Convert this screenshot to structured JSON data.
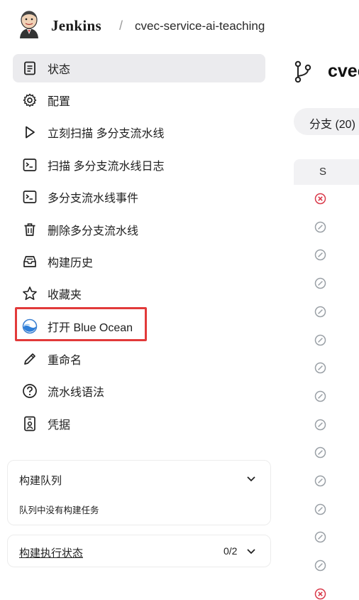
{
  "header": {
    "brand": "Jenkins",
    "separator": "/",
    "breadcrumb": "cvec-service-ai-teaching"
  },
  "sidebar": {
    "items": [
      {
        "label": "状态",
        "icon": "document-icon",
        "active": true
      },
      {
        "label": "配置",
        "icon": "gear-icon"
      },
      {
        "label": "立刻扫描 多分支流水线",
        "icon": "play-icon"
      },
      {
        "label": "扫描 多分支流水线日志",
        "icon": "terminal-icon"
      },
      {
        "label": "多分支流水线事件",
        "icon": "terminal-icon"
      },
      {
        "label": "删除多分支流水线",
        "icon": "trash-icon"
      },
      {
        "label": "构建历史",
        "icon": "inbox-icon"
      },
      {
        "label": "收藏夹",
        "icon": "star-icon"
      },
      {
        "label": "打开 Blue Ocean",
        "icon": "blue-ocean-icon",
        "highlighted": true
      },
      {
        "label": "重命名",
        "icon": "pencil-icon"
      },
      {
        "label": "流水线语法",
        "icon": "help-circle-icon"
      },
      {
        "label": "凭据",
        "icon": "credentials-icon"
      }
    ]
  },
  "build_queue": {
    "title": "构建队列",
    "empty_text": "队列中没有构建任务"
  },
  "executor_status": {
    "title": "构建执行状态",
    "count": "0/2"
  },
  "main": {
    "title": "cvec",
    "tab_label": "分支 (20)",
    "column_s": "S",
    "statuses": [
      "failed",
      "disabled",
      "disabled",
      "disabled",
      "disabled",
      "disabled",
      "disabled",
      "disabled",
      "disabled",
      "disabled",
      "disabled",
      "disabled",
      "disabled",
      "disabled",
      "failed"
    ]
  },
  "colors": {
    "accent_red": "#e23a3a",
    "failed": "#d9394a",
    "disabled": "#9aa0a6",
    "active_bg": "#ebebee"
  }
}
